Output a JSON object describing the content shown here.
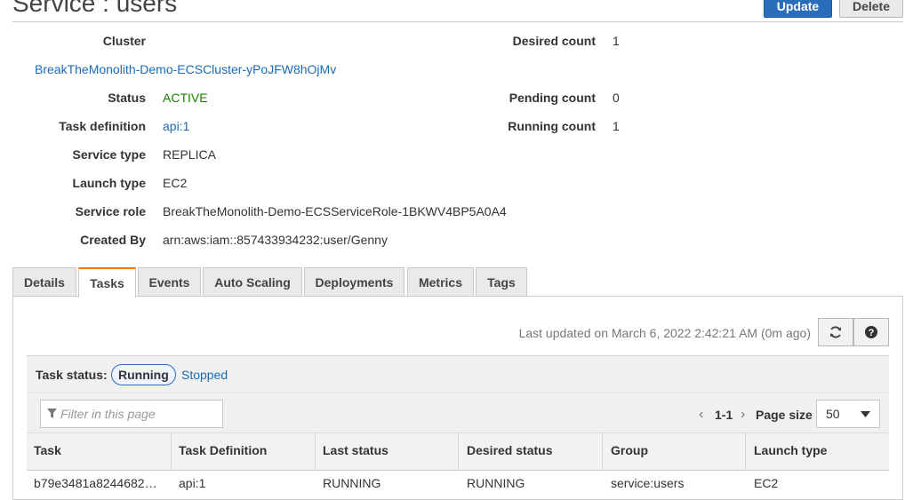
{
  "page": {
    "title": "Service : users"
  },
  "actions": {
    "update_label": "Update",
    "delete_label": "Delete"
  },
  "details": {
    "cluster_label": "Cluster",
    "cluster_value": "BreakTheMonolith-Demo-ECSCluster-yPoJFW8hOjMv",
    "status_label": "Status",
    "status_value": "ACTIVE",
    "task_def_label": "Task definition",
    "task_def_value": "api:1",
    "service_type_label": "Service type",
    "service_type_value": "REPLICA",
    "launch_type_label": "Launch type",
    "launch_type_value": "EC2",
    "service_role_label": "Service role",
    "service_role_value": "BreakTheMonolith-Demo-ECSServiceRole-1BKWV4BP5A0A4",
    "created_by_label": "Created By",
    "created_by_value": "arn:aws:iam::857433934232:user/Genny",
    "desired_count_label": "Desired count",
    "desired_count_value": "1",
    "pending_count_label": "Pending count",
    "pending_count_value": "0",
    "running_count_label": "Running count",
    "running_count_value": "1"
  },
  "tabs": [
    {
      "label": "Details"
    },
    {
      "label": "Tasks"
    },
    {
      "label": "Events"
    },
    {
      "label": "Auto Scaling"
    },
    {
      "label": "Deployments"
    },
    {
      "label": "Metrics"
    },
    {
      "label": "Tags"
    }
  ],
  "selected_tab": "Tasks",
  "tasks": {
    "last_updated": "Last updated on March 6, 2022 2:42:21 AM (0m ago)",
    "status_label": "Task status:",
    "status_running": "Running",
    "status_stopped": "Stopped",
    "filter_placeholder": "Filter in this page",
    "pagination": "1-1",
    "page_size_label": "Page size",
    "page_size_value": "50",
    "columns": [
      "Task",
      "Task Definition",
      "Last status",
      "Desired status",
      "Group",
      "Launch type"
    ],
    "rows": [
      [
        "b79e3481a8244682…",
        "api:1",
        "RUNNING",
        "RUNNING",
        "service:users",
        "EC2"
      ]
    ]
  },
  "colors": {
    "accent": "#2a6ebb",
    "link": "#1a6bb6",
    "active": "#1d8102",
    "tab_highlight": "#e47911"
  },
  "icons": [
    "refresh-icon",
    "help-icon",
    "filter-icon",
    "chevron-left-icon",
    "chevron-right-icon",
    "caret-down-icon"
  ]
}
